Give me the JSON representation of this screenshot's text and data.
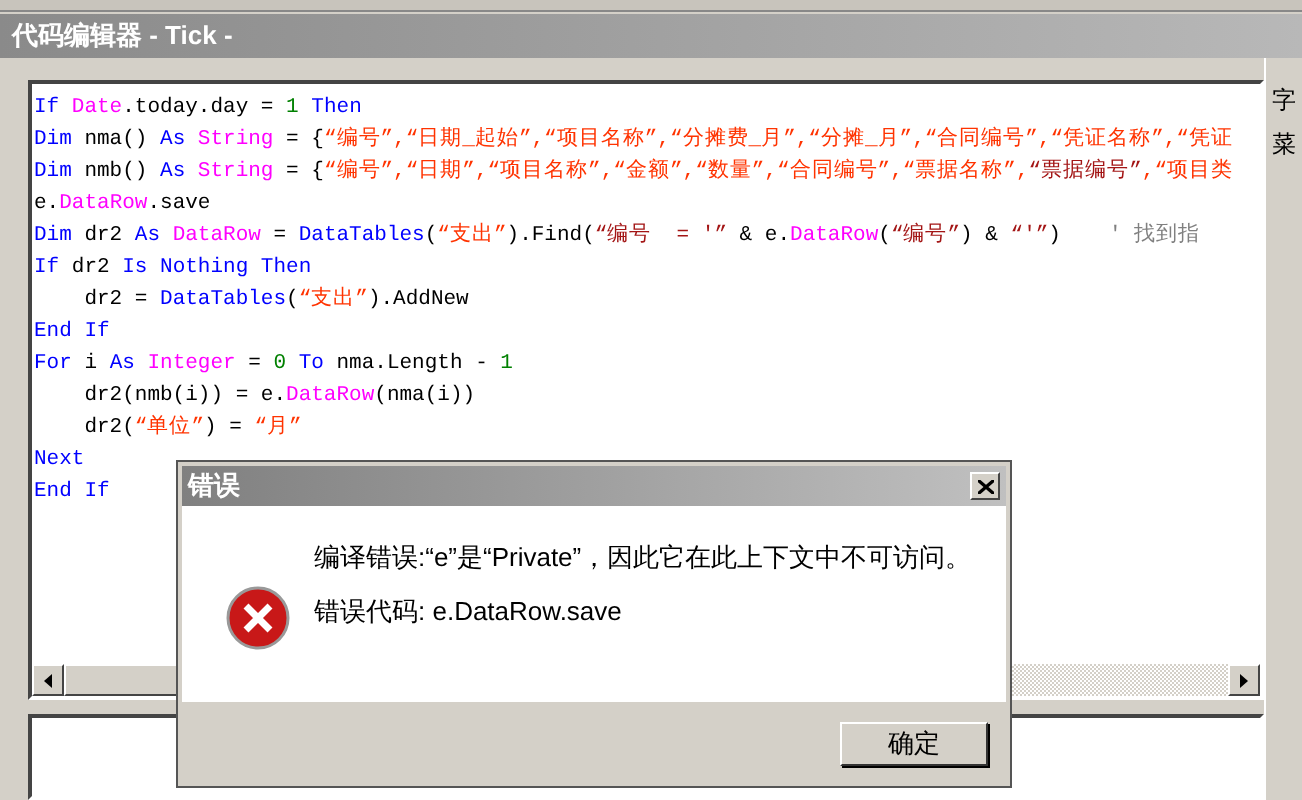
{
  "window": {
    "title": "代码编辑器 - Tick -"
  },
  "editor": {
    "lines": [
      {
        "tokens": [
          {
            "kind": "kw",
            "text": "If "
          },
          {
            "kind": "type",
            "text": "Date"
          },
          {
            "kind": "plain",
            "text": ".today.day = "
          },
          {
            "kind": "num",
            "text": "1"
          },
          {
            "kind": "kw",
            "text": " Then"
          }
        ]
      },
      {
        "tokens": [
          {
            "kind": "kw",
            "text": "Dim"
          },
          {
            "kind": "plain",
            "text": " nma() "
          },
          {
            "kind": "kw",
            "text": "As "
          },
          {
            "kind": "type",
            "text": "String"
          },
          {
            "kind": "plain",
            "text": " = {"
          },
          {
            "kind": "str",
            "text": "“编号”,“日期_起始”,“项目名称”,“分摊费_月”,“分摊_月”,“合同编号”,“凭证名称”,“凭证"
          }
        ]
      },
      {
        "tokens": [
          {
            "kind": "kw",
            "text": "Dim"
          },
          {
            "kind": "plain",
            "text": " nmb() "
          },
          {
            "kind": "kw",
            "text": "As "
          },
          {
            "kind": "type",
            "text": "String"
          },
          {
            "kind": "plain",
            "text": " = {"
          },
          {
            "kind": "str",
            "text": "“编号”,“日期”,“项目名称”,“金额”,“数量”,“合同编号”,“票据名称”,"
          },
          {
            "kind": "str2",
            "text": "“票据编号”"
          },
          {
            "kind": "str",
            "text": ",“项目类"
          }
        ]
      },
      {
        "tokens": [
          {
            "kind": "plain",
            "text": "e."
          },
          {
            "kind": "type",
            "text": "DataRow"
          },
          {
            "kind": "plain",
            "text": ".save"
          }
        ]
      },
      {
        "tokens": [
          {
            "kind": "kw",
            "text": "Dim"
          },
          {
            "kind": "plain",
            "text": " dr2 "
          },
          {
            "kind": "kw",
            "text": "As "
          },
          {
            "kind": "type",
            "text": "DataRow"
          },
          {
            "kind": "plain",
            "text": " = "
          },
          {
            "kind": "kw",
            "text": "DataTables"
          },
          {
            "kind": "plain",
            "text": "("
          },
          {
            "kind": "str",
            "text": "“支出”"
          },
          {
            "kind": "plain",
            "text": ").Find("
          },
          {
            "kind": "str2",
            "text": "“编号  = '”"
          },
          {
            "kind": "plain",
            "text": " & e."
          },
          {
            "kind": "type",
            "text": "DataRow"
          },
          {
            "kind": "plain",
            "text": "("
          },
          {
            "kind": "str2",
            "text": "“编号”"
          },
          {
            "kind": "plain",
            "text": ") & "
          },
          {
            "kind": "str2",
            "text": "“'”"
          },
          {
            "kind": "plain",
            "text": ")"
          },
          {
            "kind": "comment",
            "text": "' 找到指"
          }
        ]
      },
      {
        "tokens": [
          {
            "kind": "kw",
            "text": "If"
          },
          {
            "kind": "plain",
            "text": " dr2 "
          },
          {
            "kind": "kw",
            "text": "Is Nothing Then"
          }
        ]
      },
      {
        "tokens": [
          {
            "kind": "plain",
            "text": "    dr2 = "
          },
          {
            "kind": "kw",
            "text": "DataTables"
          },
          {
            "kind": "plain",
            "text": "("
          },
          {
            "kind": "str",
            "text": "“支出”"
          },
          {
            "kind": "plain",
            "text": ").AddNew"
          }
        ]
      },
      {
        "tokens": [
          {
            "kind": "kw",
            "text": "End If"
          }
        ]
      },
      {
        "tokens": [
          {
            "kind": "kw",
            "text": "For"
          },
          {
            "kind": "plain",
            "text": " i "
          },
          {
            "kind": "kw",
            "text": "As "
          },
          {
            "kind": "type",
            "text": "Integer"
          },
          {
            "kind": "plain",
            "text": " = "
          },
          {
            "kind": "num",
            "text": "0"
          },
          {
            "kind": "kw",
            "text": " To"
          },
          {
            "kind": "plain",
            "text": " nma.Length - "
          },
          {
            "kind": "num",
            "text": "1"
          }
        ]
      },
      {
        "tokens": [
          {
            "kind": "plain",
            "text": "    dr2(nmb(i)) = e."
          },
          {
            "kind": "type",
            "text": "DataRow"
          },
          {
            "kind": "plain",
            "text": "(nma(i))"
          }
        ]
      },
      {
        "tokens": [
          {
            "kind": "plain",
            "text": "    dr2("
          },
          {
            "kind": "str",
            "text": "“单位”"
          },
          {
            "kind": "plain",
            "text": ") = "
          },
          {
            "kind": "str",
            "text": "“月”"
          }
        ]
      },
      {
        "tokens": [
          {
            "kind": "kw",
            "text": "Next"
          }
        ]
      },
      {
        "tokens": [
          {
            "kind": "kw",
            "text": "End If"
          }
        ]
      }
    ]
  },
  "side_panel": {
    "labels": [
      "字",
      "菜"
    ]
  },
  "dialog": {
    "title": "错误",
    "message": "编译错误:“e”是“Private”，因此它在此上下文中不可访问。",
    "error_code": "错误代码: e.DataRow.save",
    "ok_button": "确定"
  }
}
